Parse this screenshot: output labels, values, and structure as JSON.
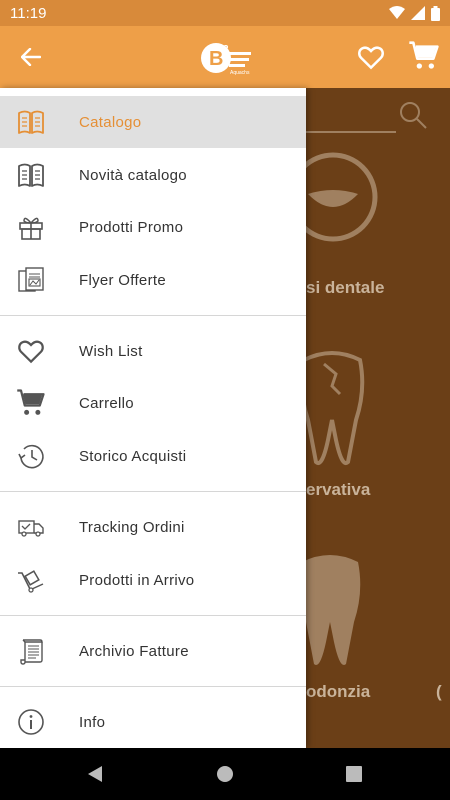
{
  "status": {
    "time": "11:19"
  },
  "header": {
    "logo_text": "B²",
    "logo_sub": "Aquachs"
  },
  "background": {
    "categories": [
      {
        "label": "si dentale"
      },
      {
        "label": "ervativa"
      },
      {
        "label": "odonzia"
      }
    ]
  },
  "drawer": {
    "items": [
      {
        "label": "Catalogo",
        "icon": "book-icon"
      },
      {
        "label": "Novità catalogo",
        "icon": "book-icon"
      },
      {
        "label": "Prodotti Promo",
        "icon": "gift-icon"
      },
      {
        "label": "Flyer Offerte",
        "icon": "flyer-icon"
      },
      {
        "label": "Wish List",
        "icon": "heart-icon"
      },
      {
        "label": "Carrello",
        "icon": "cart-icon"
      },
      {
        "label": "Storico Acquisti",
        "icon": "history-icon"
      },
      {
        "label": "Tracking Ordini",
        "icon": "truck-icon"
      },
      {
        "label": "Prodotti in Arrivo",
        "icon": "hand-truck-icon"
      },
      {
        "label": "Archivio Fatture",
        "icon": "invoice-scroll-icon"
      },
      {
        "label": "Info",
        "icon": "info-icon"
      }
    ],
    "active_item": "Catalogo"
  },
  "colors": {
    "accent": "#ee9f48",
    "status_bar": "#d88a3a",
    "active_text": "#e58f35",
    "active_bg": "#e0e0e0",
    "scrim_content": "#6b3f17"
  }
}
